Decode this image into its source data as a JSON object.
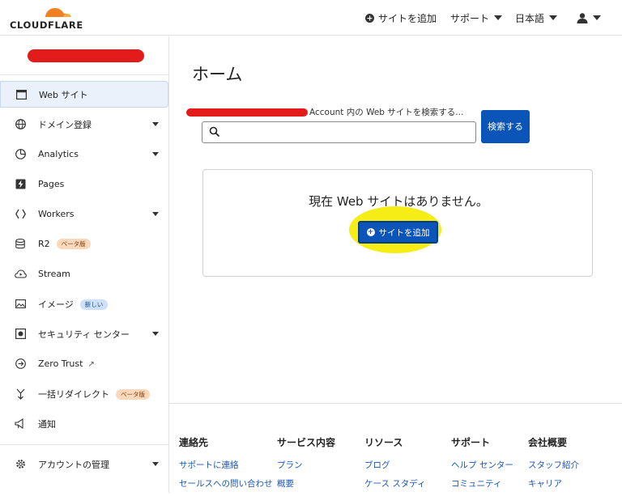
{
  "header": {
    "logo_text": "CLOUDFLARE",
    "add_site_label": "サイトを追加",
    "support_label": "サポート",
    "language_label": "日本語"
  },
  "sidebar": {
    "account_name": "",
    "items": [
      {
        "label": "Web サイト",
        "icon": "window-icon"
      },
      {
        "label": "ドメイン登録",
        "icon": "globe-icon"
      },
      {
        "label": "Analytics",
        "icon": "pie-chart-icon"
      },
      {
        "label": "Pages",
        "icon": "lightning-icon"
      },
      {
        "label": "Workers",
        "icon": "workers-icon"
      },
      {
        "label": "R2",
        "icon": "storage-icon",
        "badge": "ベータ版"
      },
      {
        "label": "Stream",
        "icon": "cloud-icon"
      },
      {
        "label": "イメージ",
        "icon": "image-icon",
        "badge": "新しい"
      },
      {
        "label": "セキュリティ センター",
        "icon": "security-icon"
      },
      {
        "label": "Zero Trust",
        "icon": "zero-trust-icon"
      },
      {
        "label": "一括リダイレクト",
        "icon": "redirect-icon",
        "badge": "ベータ版"
      },
      {
        "label": "通知",
        "icon": "megaphone-icon"
      },
      {
        "label": "アカウントの管理",
        "icon": "gear-icon"
      }
    ]
  },
  "main": {
    "title": "ホーム",
    "search_label": "Account 内の Web サイトを検索する...",
    "search_value": "",
    "search_button": "検索する",
    "empty_message": "現在 Web サイトはありません。",
    "add_site_button": "サイトを追加"
  },
  "footer": {
    "columns": [
      {
        "heading": "連絡先",
        "links": [
          "サポートに連絡",
          "セールスへの問い合わせ"
        ]
      },
      {
        "heading": "サービス内容",
        "links": [
          "プラン",
          "概要"
        ]
      },
      {
        "heading": "リソース",
        "links": [
          "ブログ",
          "ケース スタディ"
        ]
      },
      {
        "heading": "サポート",
        "links": [
          "ヘルプ センター",
          "コミュニティ"
        ]
      },
      {
        "heading": "会社概要",
        "links": [
          "スタッフ紹介",
          "キャリア"
        ]
      }
    ]
  },
  "colors": {
    "brand_orange": "#f38020",
    "primary_blue": "#0b55b8",
    "link_blue": "#1a56b8",
    "redaction_red": "#e41b1b",
    "highlight_yellow": "#f6ec16"
  }
}
